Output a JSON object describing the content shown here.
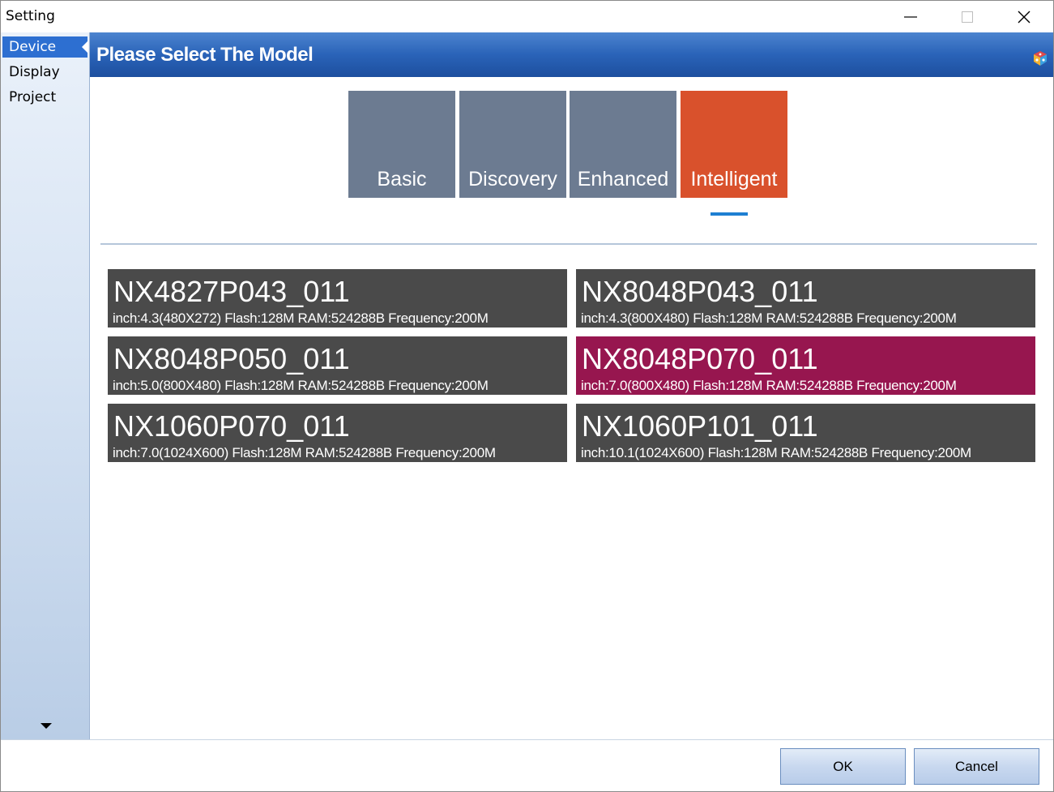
{
  "window": {
    "title": "Setting"
  },
  "sidebar": {
    "items": [
      {
        "label": "Device",
        "active": true
      },
      {
        "label": "Display",
        "active": false
      },
      {
        "label": "Project",
        "active": false
      }
    ],
    "scroll_icon": "triangle-down-icon"
  },
  "header": {
    "title": "Please Select The Model",
    "icon": "cube-icon"
  },
  "categories": [
    {
      "label": "Basic",
      "active": false
    },
    {
      "label": "Discovery",
      "active": false
    },
    {
      "label": "Enhanced",
      "active": false
    },
    {
      "label": "Intelligent",
      "active": true
    }
  ],
  "models": [
    {
      "name": "NX4827P043_011",
      "spec": "inch:4.3(480X272) Flash:128M RAM:524288B Frequency:200M",
      "selected": false
    },
    {
      "name": "NX8048P043_011",
      "spec": "inch:4.3(800X480) Flash:128M RAM:524288B Frequency:200M",
      "selected": false
    },
    {
      "name": "NX8048P050_011",
      "spec": "inch:5.0(800X480) Flash:128M RAM:524288B Frequency:200M",
      "selected": false
    },
    {
      "name": "NX8048P070_011",
      "spec": "inch:7.0(800X480) Flash:128M RAM:524288B Frequency:200M",
      "selected": true
    },
    {
      "name": "NX1060P070_011",
      "spec": "inch:7.0(1024X600) Flash:128M RAM:524288B Frequency:200M",
      "selected": false
    },
    {
      "name": "NX1060P101_011",
      "spec": "inch:10.1(1024X600) Flash:128M RAM:524288B Frequency:200M",
      "selected": false
    }
  ],
  "buttons": {
    "ok_label": "OK",
    "cancel_label": "Cancel"
  },
  "colors": {
    "tile_default": "#6c7b91",
    "tile_active": "#d9512c",
    "card_default": "#4a4a4a",
    "card_selected": "#97164f",
    "header_blue": "#2a63b8",
    "sidebar_active": "#2d6fd1"
  }
}
